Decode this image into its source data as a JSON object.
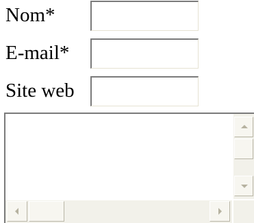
{
  "form": {
    "fields": [
      {
        "label": "Nom*",
        "value": ""
      },
      {
        "label": "E-mail*",
        "value": ""
      },
      {
        "label": "Site web",
        "value": ""
      }
    ],
    "comment": {
      "value": ""
    }
  },
  "icons": {
    "scroll_up": "triangle-up",
    "scroll_down": "triangle-down",
    "scroll_left": "triangle-left",
    "scroll_right": "triangle-right"
  },
  "colors": {
    "field_border_dark": "#7a7a7a",
    "field_border_light": "#e6e2d2",
    "scrollbar_track": "#f2f1ea",
    "scrollbar_button": "#f7f6f0",
    "arrow": "#b6b2a0"
  }
}
